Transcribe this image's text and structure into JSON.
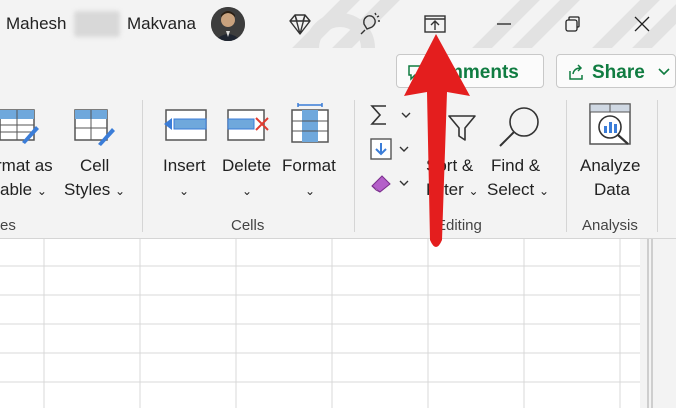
{
  "titlebar": {
    "user_first": "Mahesh",
    "user_last": "Makvana",
    "icons": [
      "diamond-icon",
      "lightbulb-wand-icon",
      "present-icon",
      "minimize-icon",
      "restore-icon",
      "close-icon"
    ]
  },
  "ribbon": {
    "comments_label": "mments",
    "share_label": "Share",
    "styles": {
      "format_as_table_line1": "rmat as",
      "format_as_table_line2": "able",
      "cell_styles_line1": "Cell",
      "cell_styles_line2": "Styles",
      "group_label": "es"
    },
    "cells": {
      "insert": "Insert",
      "delete": "Delete",
      "format": "Format",
      "group_label": "Cells"
    },
    "editing": {
      "sort_line1": "Sort &",
      "sort_line2": "Filter",
      "find_line1": "Find &",
      "find_line2": "Select",
      "group_label": "Editing"
    },
    "analysis": {
      "analyze_line1": "Analyze",
      "analyze_line2": "Data",
      "group_label": "Analysis"
    }
  },
  "colors": {
    "accent_green": "#107c41",
    "arrow_red": "#e41e1e",
    "ribbon_bg": "#f3f3f3"
  }
}
